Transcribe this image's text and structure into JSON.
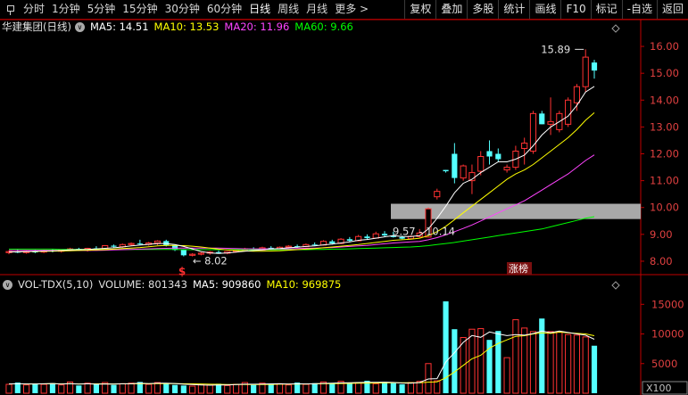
{
  "tabs": [
    "分时",
    "1分钟",
    "5分钟",
    "15分钟",
    "30分钟",
    "60分钟",
    "日线",
    "周线",
    "月线",
    "更多 >"
  ],
  "active_tab": "日线",
  "right_buttons": [
    "复权",
    "叠加",
    "多股",
    "统计",
    "画线",
    "F10",
    "标记",
    "-自选",
    "返回"
  ],
  "legend": {
    "name": "华建集团(日线)",
    "circle_icon": "∨",
    "ma5": "MA5: 14.51",
    "ma10": "MA10: 13.53",
    "ma20": "MA20: 11.96",
    "ma60": "MA60: 9.66"
  },
  "volume_legend": {
    "title": "VOL-TDX(5,10)",
    "volume": "VOLUME: 801343",
    "ma5": "MA5: 909860",
    "ma10": "MA10: 969875",
    "circle_icon": "∨"
  },
  "annotations": {
    "high": "15.89",
    "low": "8.02",
    "range_label": "9.57 - 10.14",
    "zt_label": "涨榜",
    "dollar_marker": "$",
    "x100": "X100"
  },
  "colors": {
    "up": "#ff3232",
    "down": "#54ffff",
    "ma5": "#ffffff",
    "ma10": "#ffff00",
    "ma20": "#ff44ff",
    "ma60": "#00ff00",
    "axis": "#c00000"
  },
  "chart_data": [
    {
      "type": "candlestick",
      "title": "华建集团(日线)",
      "y_ticks": [
        16.0,
        15.0,
        14.0,
        13.0,
        12.0,
        11.0,
        10.0,
        9.0,
        8.0
      ],
      "ylim": [
        7.6,
        16.4
      ],
      "shaded_range": [
        9.57,
        10.14
      ],
      "candles": [
        [
          8.32,
          8.4,
          8.26,
          8.36
        ],
        [
          8.36,
          8.44,
          8.3,
          8.32
        ],
        [
          8.32,
          8.4,
          8.28,
          8.36
        ],
        [
          8.36,
          8.42,
          8.3,
          8.34
        ],
        [
          8.34,
          8.42,
          8.3,
          8.4
        ],
        [
          8.4,
          8.45,
          8.33,
          8.37
        ],
        [
          8.37,
          8.44,
          8.32,
          8.41
        ],
        [
          8.41,
          8.5,
          8.38,
          8.46
        ],
        [
          8.46,
          8.5,
          8.38,
          8.4
        ],
        [
          8.4,
          8.5,
          8.36,
          8.48
        ],
        [
          8.48,
          8.56,
          8.42,
          8.45
        ],
        [
          8.45,
          8.6,
          8.44,
          8.58
        ],
        [
          8.58,
          8.62,
          8.5,
          8.54
        ],
        [
          8.54,
          8.66,
          8.5,
          8.62
        ],
        [
          8.62,
          8.7,
          8.58,
          8.66
        ],
        [
          8.66,
          8.8,
          8.6,
          8.64
        ],
        [
          8.62,
          8.72,
          8.58,
          8.68
        ],
        [
          8.68,
          8.78,
          8.6,
          8.75
        ],
        [
          8.75,
          8.8,
          8.55,
          8.6
        ],
        [
          8.6,
          8.62,
          8.38,
          8.42
        ],
        [
          8.42,
          8.45,
          8.18,
          8.22
        ],
        [
          8.22,
          8.3,
          8.18,
          8.26
        ],
        [
          8.26,
          8.34,
          8.22,
          8.3
        ],
        [
          8.3,
          8.38,
          8.24,
          8.34
        ],
        [
          8.34,
          8.4,
          8.28,
          8.3
        ],
        [
          8.3,
          8.38,
          8.26,
          8.36
        ],
        [
          8.36,
          8.44,
          8.32,
          8.4
        ],
        [
          8.4,
          8.5,
          8.36,
          8.46
        ],
        [
          8.46,
          8.52,
          8.38,
          8.42
        ],
        [
          8.42,
          8.54,
          8.4,
          8.5
        ],
        [
          8.5,
          8.56,
          8.42,
          8.46
        ],
        [
          8.46,
          8.55,
          8.44,
          8.52
        ],
        [
          8.52,
          8.6,
          8.48,
          8.56
        ],
        [
          8.56,
          8.62,
          8.5,
          8.54
        ],
        [
          8.54,
          8.66,
          8.52,
          8.62
        ],
        [
          8.62,
          8.7,
          8.56,
          8.6
        ],
        [
          8.6,
          8.78,
          8.58,
          8.74
        ],
        [
          8.74,
          8.8,
          8.62,
          8.66
        ],
        [
          8.66,
          8.86,
          8.64,
          8.82
        ],
        [
          8.82,
          8.9,
          8.7,
          8.76
        ],
        [
          8.76,
          8.98,
          8.74,
          8.92
        ],
        [
          8.92,
          9.0,
          8.8,
          8.86
        ],
        [
          8.86,
          9.1,
          8.84,
          9.02
        ],
        [
          9.02,
          9.12,
          8.9,
          8.96
        ],
        [
          8.96,
          9.1,
          8.88,
          8.9
        ],
        [
          8.9,
          8.95,
          8.82,
          8.84
        ],
        [
          8.84,
          8.96,
          8.82,
          8.92
        ],
        [
          8.92,
          9.2,
          8.88,
          9.05
        ],
        [
          8.9,
          10.0,
          8.88,
          9.95
        ],
        [
          10.4,
          10.7,
          10.3,
          10.6
        ],
        [
          11.4,
          11.4,
          11.3,
          11.35
        ],
        [
          12.0,
          12.4,
          10.9,
          11.1
        ],
        [
          11.1,
          11.6,
          11.0,
          11.55
        ],
        [
          11.0,
          11.6,
          10.5,
          11.3
        ],
        [
          11.35,
          12.1,
          11.2,
          11.9
        ],
        [
          12.1,
          12.5,
          11.6,
          11.9
        ],
        [
          12.0,
          12.2,
          11.7,
          11.8
        ],
        [
          11.4,
          11.6,
          11.3,
          11.5
        ],
        [
          11.5,
          12.3,
          11.4,
          12.1
        ],
        [
          12.2,
          12.6,
          11.6,
          12.4
        ],
        [
          12.1,
          13.6,
          12.0,
          13.5
        ],
        [
          13.5,
          13.6,
          13.1,
          13.1
        ],
        [
          13.1,
          14.1,
          12.7,
          13.2
        ],
        [
          12.9,
          13.6,
          12.8,
          13.5
        ],
        [
          13.1,
          14.1,
          13.0,
          14.0
        ],
        [
          13.9,
          14.6,
          13.6,
          14.5
        ],
        [
          14.5,
          15.89,
          14.3,
          15.6
        ],
        [
          15.4,
          15.5,
          14.8,
          15.1
        ]
      ],
      "ma5": [
        8.34,
        8.35,
        8.36,
        8.37,
        8.38,
        8.39,
        8.4,
        8.42,
        8.43,
        8.44,
        8.46,
        8.48,
        8.5,
        8.53,
        8.57,
        8.6,
        8.63,
        8.66,
        8.66,
        8.62,
        8.55,
        8.46,
        8.36,
        8.31,
        8.29,
        8.31,
        8.34,
        8.37,
        8.4,
        8.42,
        8.45,
        8.47,
        8.5,
        8.52,
        8.55,
        8.57,
        8.61,
        8.64,
        8.68,
        8.72,
        8.78,
        8.81,
        8.86,
        8.91,
        8.95,
        8.92,
        8.92,
        8.95,
        9.2,
        9.6,
        10.05,
        10.55,
        10.9,
        11.05,
        11.3,
        11.5,
        11.7,
        11.7,
        11.8,
        11.95,
        12.3,
        12.7,
        13.0,
        13.2,
        13.4,
        13.8,
        14.3,
        14.51
      ],
      "ma10": [
        8.35,
        8.35,
        8.36,
        8.36,
        8.37,
        8.37,
        8.38,
        8.39,
        8.4,
        8.41,
        8.42,
        8.43,
        8.45,
        8.47,
        8.49,
        8.51,
        8.54,
        8.57,
        8.59,
        8.59,
        8.58,
        8.56,
        8.53,
        8.49,
        8.45,
        8.42,
        8.4,
        8.38,
        8.37,
        8.37,
        8.38,
        8.39,
        8.41,
        8.43,
        8.45,
        8.47,
        8.5,
        8.53,
        8.56,
        8.59,
        8.62,
        8.66,
        8.7,
        8.74,
        8.78,
        8.8,
        8.82,
        8.86,
        8.95,
        9.1,
        9.3,
        9.55,
        9.8,
        10.05,
        10.3,
        10.55,
        10.8,
        11.05,
        11.25,
        11.4,
        11.6,
        11.85,
        12.1,
        12.35,
        12.6,
        12.9,
        13.25,
        13.53
      ],
      "ma20": [
        8.4,
        8.4,
        8.4,
        8.4,
        8.4,
        8.4,
        8.4,
        8.4,
        8.4,
        8.4,
        8.4,
        8.41,
        8.42,
        8.43,
        8.44,
        8.45,
        8.46,
        8.47,
        8.48,
        8.49,
        8.49,
        8.49,
        8.49,
        8.49,
        8.49,
        8.48,
        8.47,
        8.46,
        8.46,
        8.46,
        8.46,
        8.46,
        8.46,
        8.47,
        8.48,
        8.49,
        8.5,
        8.51,
        8.53,
        8.55,
        8.57,
        8.59,
        8.62,
        8.65,
        8.68,
        8.7,
        8.72,
        8.74,
        8.8,
        8.88,
        8.98,
        9.1,
        9.22,
        9.35,
        9.5,
        9.65,
        9.8,
        9.95,
        10.1,
        10.25,
        10.45,
        10.65,
        10.85,
        11.05,
        11.25,
        11.5,
        11.75,
        11.96
      ],
      "ma60": [
        8.45,
        8.45,
        8.45,
        8.45,
        8.45,
        8.45,
        8.44,
        8.44,
        8.44,
        8.44,
        8.44,
        8.44,
        8.44,
        8.44,
        8.44,
        8.44,
        8.44,
        8.44,
        8.44,
        8.44,
        8.43,
        8.43,
        8.43,
        8.43,
        8.43,
        8.43,
        8.43,
        8.43,
        8.43,
        8.43,
        8.43,
        8.43,
        8.43,
        8.43,
        8.43,
        8.44,
        8.44,
        8.45,
        8.45,
        8.46,
        8.47,
        8.48,
        8.49,
        8.5,
        8.51,
        8.52,
        8.53,
        8.55,
        8.58,
        8.62,
        8.66,
        8.7,
        8.75,
        8.8,
        8.85,
        8.9,
        8.95,
        9.0,
        9.05,
        9.1,
        9.15,
        9.2,
        9.28,
        9.36,
        9.44,
        9.52,
        9.6,
        9.66
      ]
    },
    {
      "type": "bar",
      "title": "VOL-TDX(5,10)",
      "y_ticks": [
        15000,
        10000,
        5000
      ],
      "ylim": [
        0,
        17000
      ],
      "unit": "X100",
      "volume": [
        1500,
        1800,
        1400,
        1600,
        1500,
        1700,
        1400,
        1900,
        1300,
        1700,
        1500,
        1800,
        1400,
        1600,
        1700,
        1900,
        1500,
        1800,
        1600,
        1400,
        1300,
        1200,
        1500,
        1400,
        1600,
        1300,
        1500,
        1800,
        1400,
        1700,
        1500,
        1600,
        1400,
        1800,
        1500,
        1700,
        1900,
        1600,
        2000,
        1700,
        1800,
        2100,
        1600,
        1900,
        1700,
        1500,
        1800,
        2000,
        5000,
        2100,
        15500,
        10800,
        9400,
        10800,
        10900,
        9000,
        10500,
        6000,
        12400,
        11000,
        10400,
        12600,
        10400,
        10300,
        9900,
        9800,
        9500,
        8013
      ],
      "ma5": [
        1560,
        1600,
        1560,
        1560,
        1600,
        1640,
        1540,
        1620,
        1540,
        1600,
        1520,
        1560,
        1540,
        1600,
        1600,
        1680,
        1620,
        1700,
        1700,
        1640,
        1520,
        1460,
        1400,
        1360,
        1400,
        1400,
        1460,
        1520,
        1520,
        1540,
        1580,
        1600,
        1540,
        1600,
        1560,
        1600,
        1660,
        1700,
        1740,
        1780,
        1800,
        1840,
        1840,
        1860,
        1820,
        1720,
        1700,
        1800,
        2400,
        2460,
        5280,
        6860,
        8580,
        9740,
        9440,
        10340,
        10000,
        9720,
        9880,
        9800,
        10060,
        10480,
        10220,
        10500,
        10240,
        10000,
        9800,
        9099
      ],
      "ma10": [
        1560,
        1580,
        1570,
        1570,
        1580,
        1590,
        1580,
        1590,
        1570,
        1580,
        1580,
        1580,
        1560,
        1580,
        1580,
        1610,
        1600,
        1620,
        1620,
        1620,
        1600,
        1580,
        1560,
        1520,
        1500,
        1470,
        1460,
        1460,
        1460,
        1470,
        1490,
        1520,
        1530,
        1550,
        1560,
        1580,
        1600,
        1620,
        1640,
        1660,
        1680,
        1700,
        1720,
        1740,
        1760,
        1760,
        1760,
        1780,
        1860,
        1920,
        2600,
        3600,
        4700,
        5800,
        6400,
        7600,
        8400,
        9000,
        9600,
        9700,
        10000,
        10200,
        10100,
        10300,
        10200,
        10100,
        10000,
        9699
      ]
    }
  ]
}
